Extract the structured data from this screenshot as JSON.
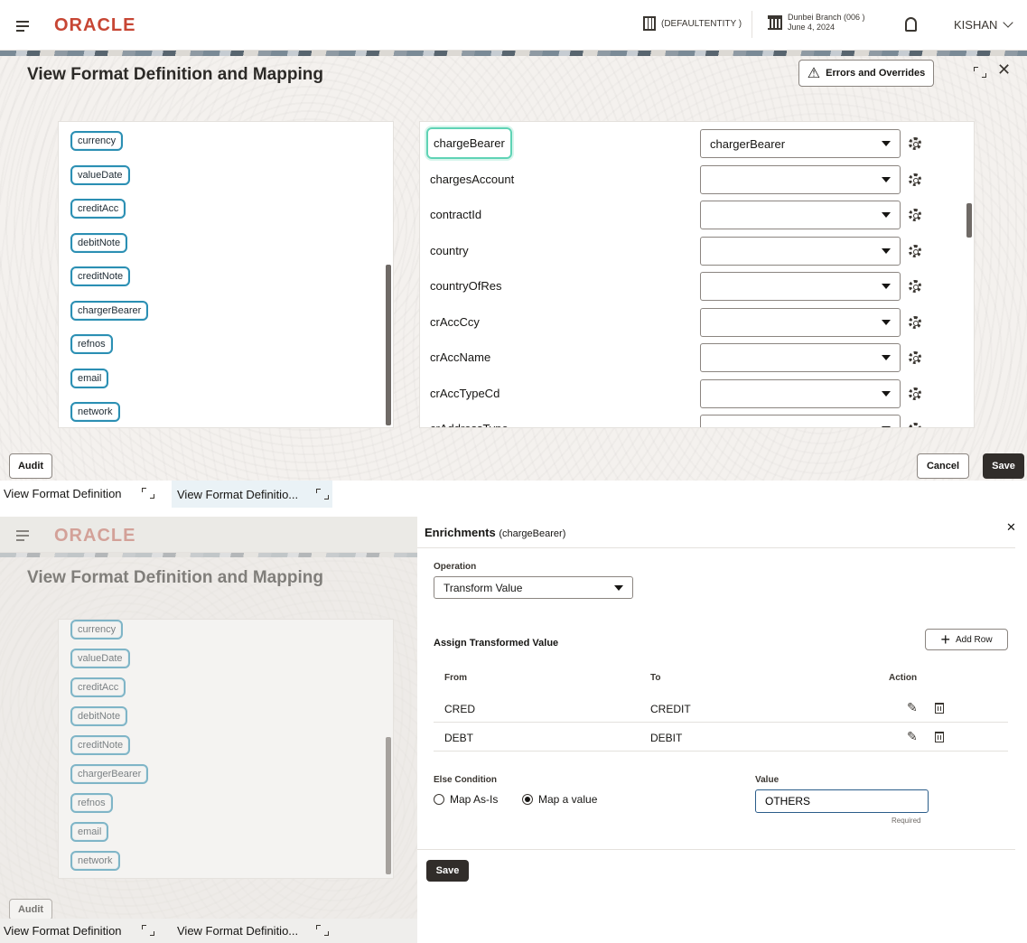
{
  "header": {
    "brand": "ORACLE",
    "entity": "(DEFAULTENTITY )",
    "branch_name": "Dunbei Branch (006 )",
    "branch_date": "June 4, 2024",
    "user": "KISHAN"
  },
  "page": {
    "title": "View Format Definition and Mapping",
    "errors_button": "Errors and Overrides",
    "audit_button": "Audit",
    "cancel_button": "Cancel",
    "save_button": "Save"
  },
  "source_fields": [
    "currency",
    "valueDate",
    "creditAcc",
    "debitNote",
    "creditNote",
    "chargerBearer",
    "refnos",
    "email",
    "network"
  ],
  "mapping_rows": [
    {
      "field": "chargeBearer",
      "value": "chargerBearer"
    },
    {
      "field": "chargesAccount",
      "value": ""
    },
    {
      "field": "contractId",
      "value": ""
    },
    {
      "field": "country",
      "value": ""
    },
    {
      "field": "countryOfRes",
      "value": ""
    },
    {
      "field": "crAccCcy",
      "value": ""
    },
    {
      "field": "crAccName",
      "value": ""
    },
    {
      "field": "crAccTypeCd",
      "value": ""
    },
    {
      "field": "crAddressType",
      "value": ""
    }
  ],
  "taskbar": {
    "tab1": "View Format Definition",
    "tab2": "View Format Definitio..."
  },
  "enrichments": {
    "title": "Enrichments",
    "subtitle": "(chargeBearer)",
    "operation_label": "Operation",
    "operation_value": "Transform Value",
    "assign_label": "Assign Transformed Value",
    "add_row": "Add Row",
    "col_from": "From",
    "col_to": "To",
    "col_action": "Action",
    "rows": [
      {
        "from": "CRED",
        "to": "CREDIT"
      },
      {
        "from": "DEBT",
        "to": "DEBIT"
      }
    ],
    "else_label": "Else Condition",
    "radio_1": "Map As-Is",
    "radio_2": "Map a value",
    "value_label": "Value",
    "value": "OTHERS",
    "required": "Required",
    "save": "Save"
  },
  "colors": {
    "brand": "#c74634",
    "chip_border": "#2b8fb3",
    "dark_button": "#312d2a"
  }
}
